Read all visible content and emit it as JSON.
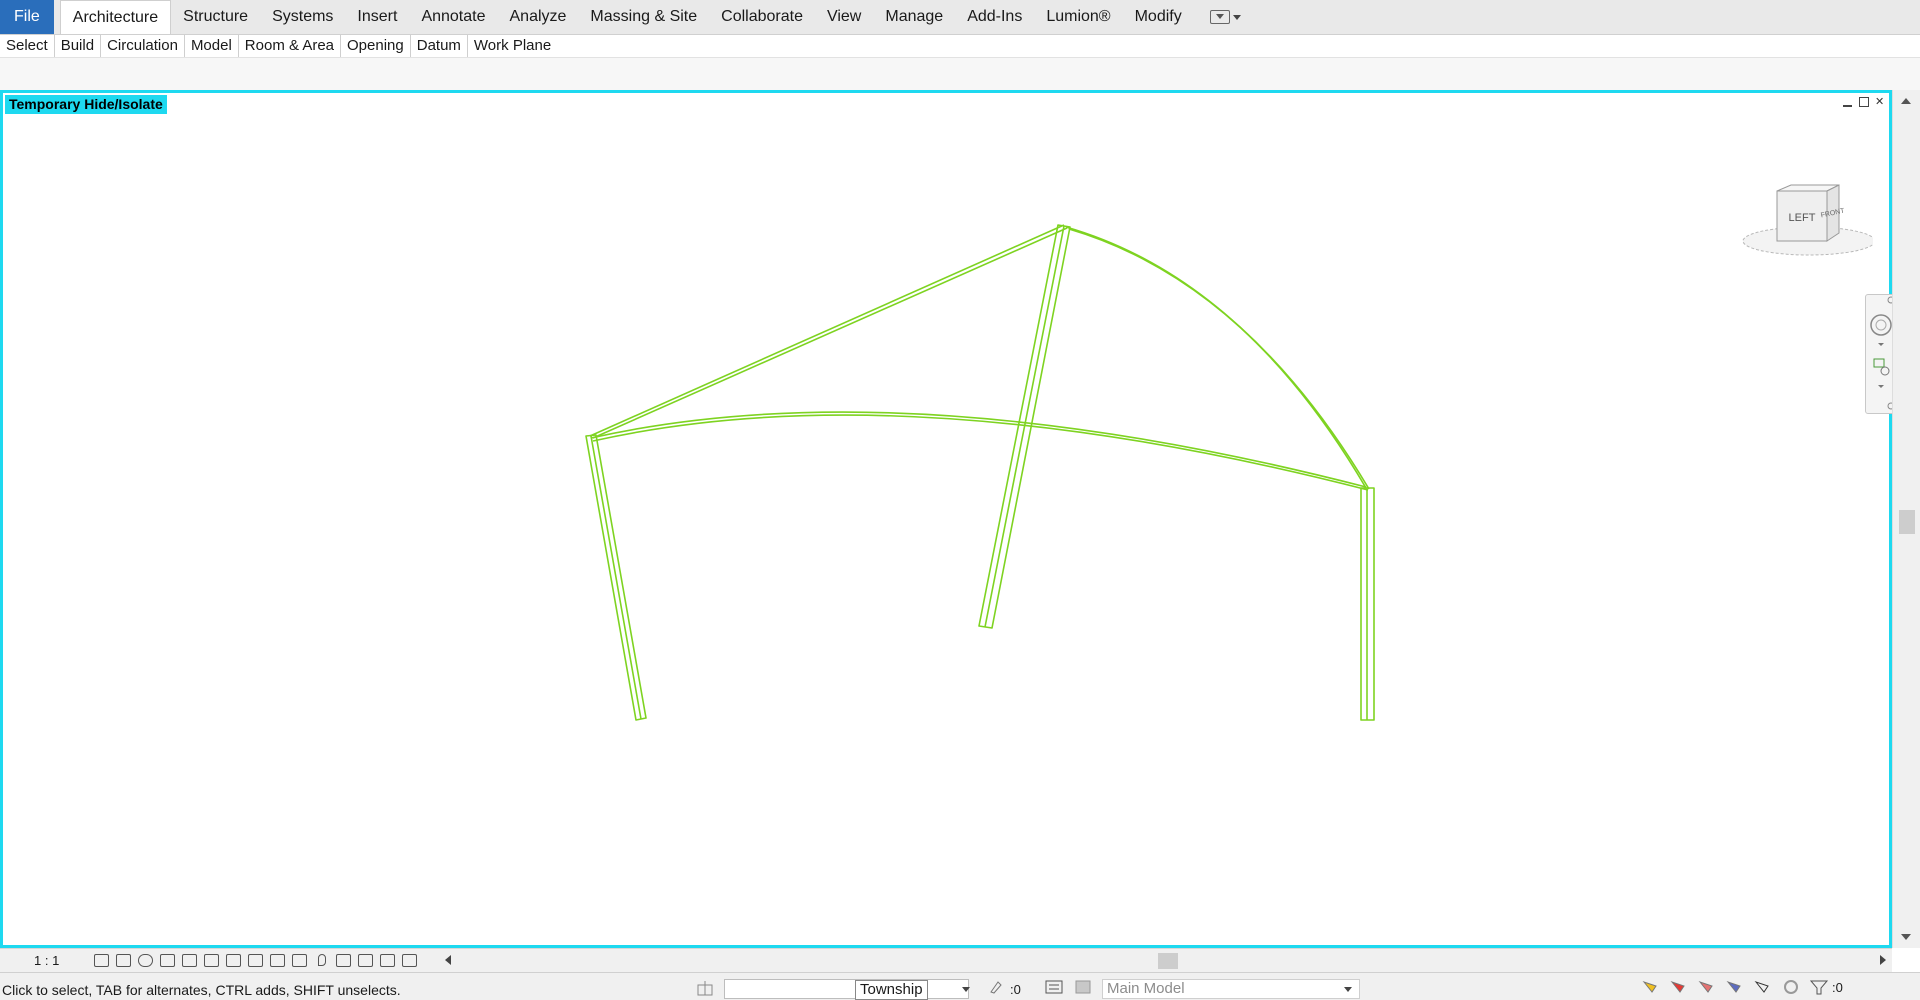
{
  "ribbon": {
    "tabs": [
      {
        "label": "File"
      },
      {
        "label": "Architecture"
      },
      {
        "label": "Structure"
      },
      {
        "label": "Systems"
      },
      {
        "label": "Insert"
      },
      {
        "label": "Annotate"
      },
      {
        "label": "Analyze"
      },
      {
        "label": "Massing & Site"
      },
      {
        "label": "Collaborate"
      },
      {
        "label": "View"
      },
      {
        "label": "Manage"
      },
      {
        "label": "Add-Ins"
      },
      {
        "label": "Lumion®"
      },
      {
        "label": "Modify"
      }
    ],
    "active_tab": "Architecture",
    "panels": [
      {
        "label": "Select"
      },
      {
        "label": "Build"
      },
      {
        "label": "Circulation"
      },
      {
        "label": "Model"
      },
      {
        "label": "Room & Area"
      },
      {
        "label": "Opening"
      },
      {
        "label": "Datum"
      },
      {
        "label": "Work Plane"
      }
    ]
  },
  "viewport": {
    "mode_label": "Temporary Hide/Isolate",
    "border_color": "#1ed9f0",
    "model_color": "#7ed321",
    "viewcube": {
      "face_left": "LEFT",
      "face_front": "FRONT"
    }
  },
  "view_control_bar": {
    "scale": "1 : 1"
  },
  "status_bar": {
    "message": "Click to select, TAB for alternates, CTRL adds, SHIFT unselects.",
    "workset": "Township",
    "editing_requests": ":0",
    "design_option": "Main Model",
    "filter_count": ":0"
  }
}
